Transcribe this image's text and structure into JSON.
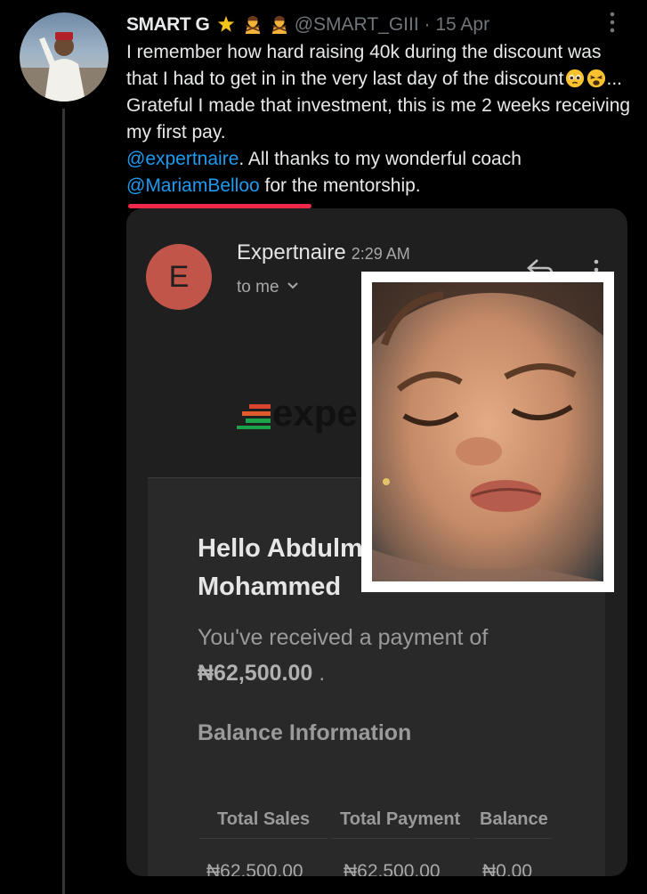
{
  "tweet": {
    "author_name": "SMART G",
    "handle": "@SMART_GIII",
    "separator": "·",
    "date": "15 Apr",
    "text_part1": "I remember how hard raising 40k during the discount was that I had to get in in the very last day of the discount",
    "text_part2": "... Grateful I made that investment, this is me 2 weeks receiving my first pay.",
    "mention1": "@expertnaire",
    "text_part3": ". All thanks to my wonderful coach ",
    "mention2": "@MariamBelloo",
    "text_part4": " for the mentorship."
  },
  "email": {
    "avatar_letter": "E",
    "sender": "Expertnaire",
    "time": "2:29 AM",
    "to": "to me",
    "logo_text": "expe",
    "greeting_line1": "Hello Abdulm",
    "greeting_line2": "Mohammed",
    "received_text": "You've received a payment of",
    "amount": "₦62,500.00",
    "amount_suffix": ".",
    "balance_heading": "Balance Information",
    "table": {
      "headers": [
        "Total Sales",
        "Total Payment",
        "Balance"
      ],
      "values": [
        "₦62,500.00",
        "₦62,500.00",
        "₦0.00"
      ]
    }
  },
  "colors": {
    "background": "#000000",
    "mention": "#1d9bf0",
    "underline": "#f0284a",
    "email_avatar": "#c2554a"
  },
  "icons": [
    "star-emoji",
    "person-gesturing-emoji",
    "pleading-face-emoji",
    "weary-face-emoji",
    "more-icon",
    "chevron-down-icon",
    "reply-icon",
    "kebab-icon"
  ]
}
